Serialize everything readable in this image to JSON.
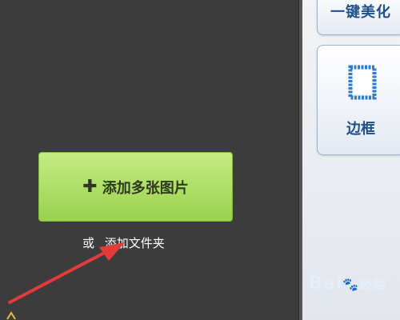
{
  "right_panel": {
    "beautify_label": "一键美化",
    "frame_label": "边框"
  },
  "main": {
    "add_images_label": "添加多张图片",
    "or_label": "或",
    "add_folder_label": "添加文件夹"
  },
  "watermark": {
    "brand": "Bai",
    "brand_suffix": "经验",
    "sub": "jingyan.baidu.com"
  },
  "colors": {
    "canvas_bg": "#3c3c3c",
    "add_button": "#99d24c",
    "annotation_arrow": "#e53a3a",
    "tool_text": "#1f4f8a"
  }
}
